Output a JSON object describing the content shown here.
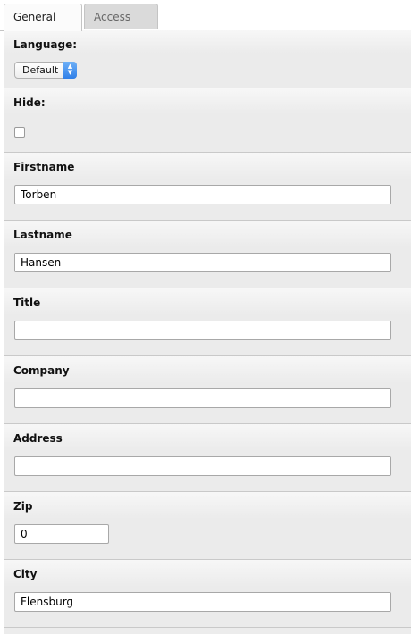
{
  "tabs": [
    {
      "label": "General",
      "active": true
    },
    {
      "label": "Access",
      "active": false
    }
  ],
  "fields": {
    "language": {
      "label": "Language:",
      "selected": "Default"
    },
    "hide": {
      "label": "Hide:",
      "checked": false
    },
    "firstname": {
      "label": "Firstname",
      "value": "Torben"
    },
    "lastname": {
      "label": "Lastname",
      "value": "Hansen"
    },
    "title": {
      "label": "Title",
      "value": ""
    },
    "company": {
      "label": "Company",
      "value": ""
    },
    "address": {
      "label": "Address",
      "value": ""
    },
    "zip": {
      "label": "Zip",
      "value": "0"
    },
    "city": {
      "label": "City",
      "value": "Flensburg"
    }
  },
  "icons": {
    "select_arrows": "up-down-chevron-icon"
  },
  "colors": {
    "select_accent": "#3b8bee",
    "panel_bg": "#ebebeb",
    "border": "#c9c9c9"
  }
}
